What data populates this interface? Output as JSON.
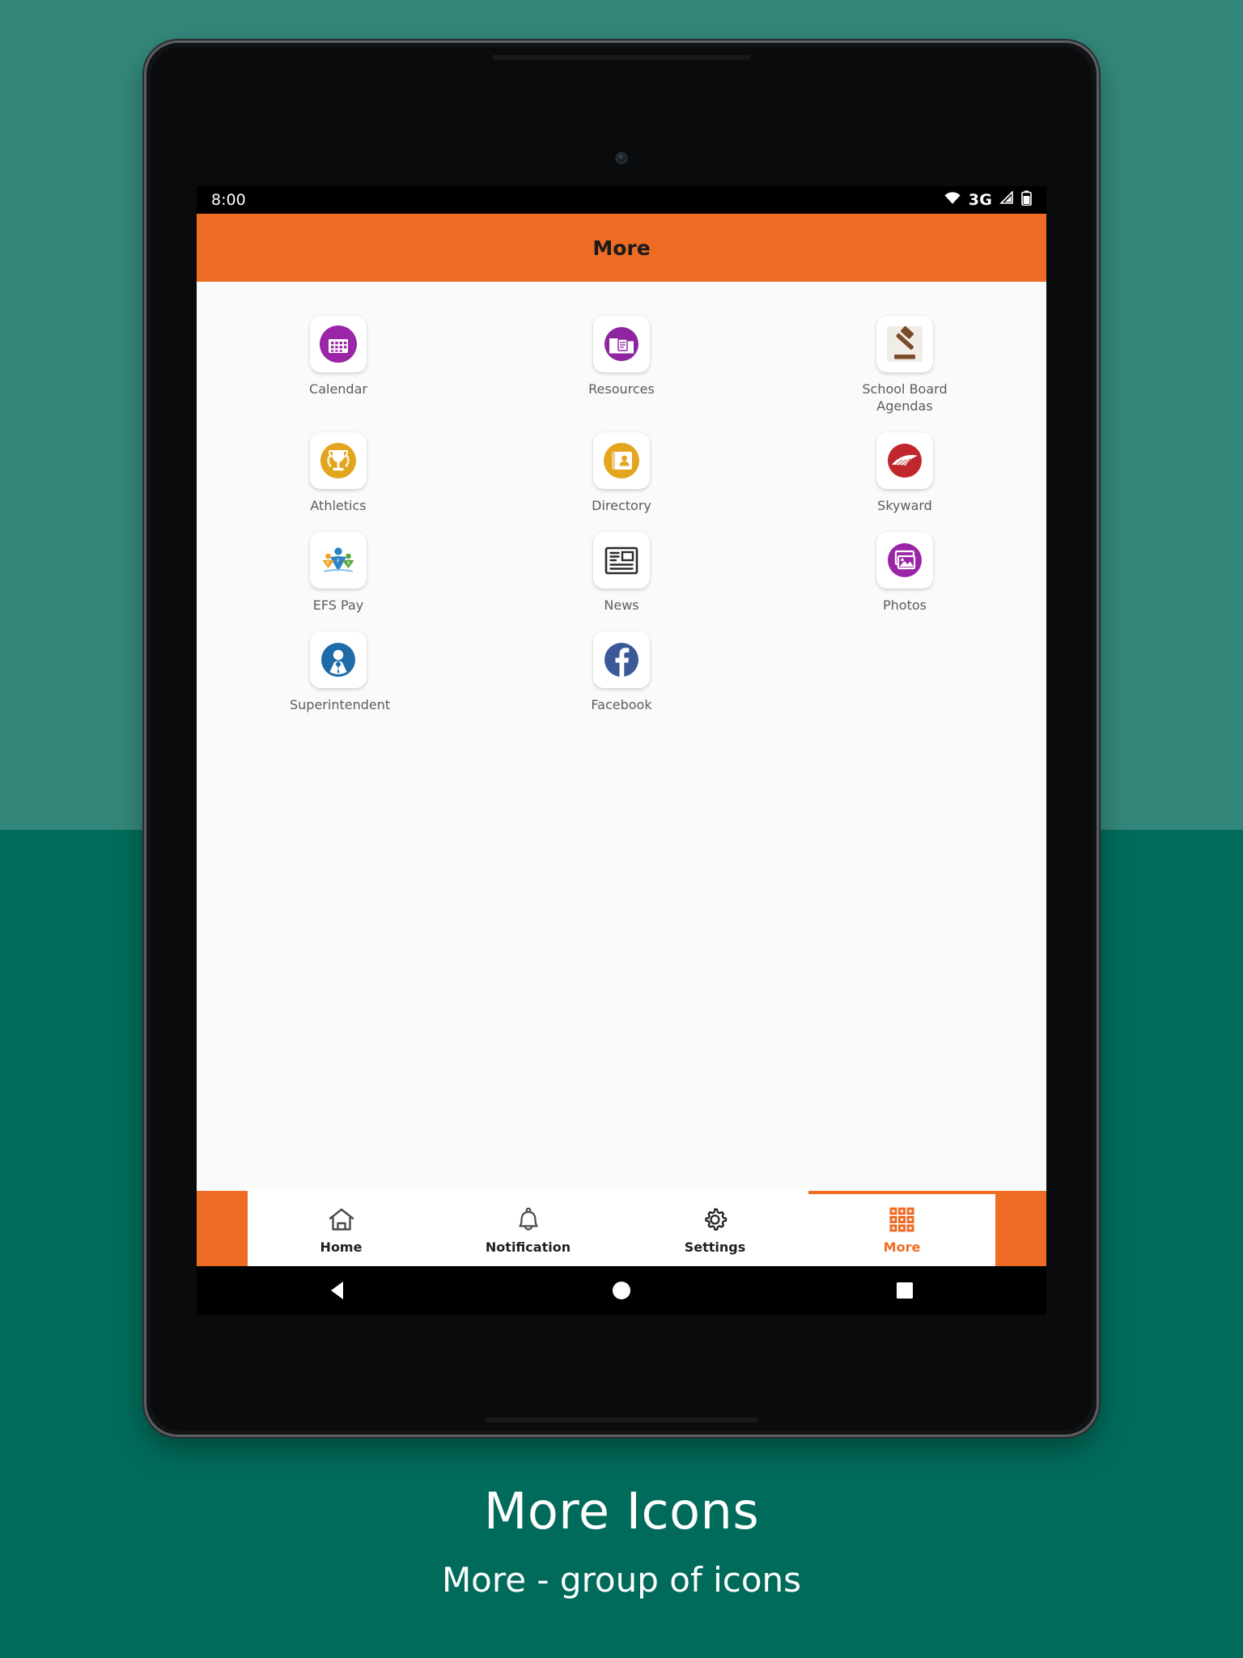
{
  "background": {
    "top_color": "#33877A",
    "bottom_color": "#006B5A"
  },
  "device": {
    "type": "android-tablet",
    "frame_color": "#111315"
  },
  "status_bar": {
    "time": "8:00",
    "network_label": "3G",
    "icons": [
      "wifi-icon",
      "signal-icon",
      "battery-icon"
    ],
    "background": "#000000"
  },
  "app_bar": {
    "title": "More",
    "background": "#EF6C25",
    "text_color": "#1b1b1b"
  },
  "tiles": [
    {
      "label": "Calendar",
      "icon": "calendar-icon",
      "color": "#9B25A7"
    },
    {
      "label": "Resources",
      "icon": "folder-document-icon",
      "color": "#8E24A0"
    },
    {
      "label": "School Board\nAgendas",
      "icon": "gavel-icon",
      "color": "#7B4A28"
    },
    {
      "label": "Athletics",
      "icon": "trophy-icon",
      "color": "#E3A51E"
    },
    {
      "label": "Directory",
      "icon": "contact-card-icon",
      "color": "#E3A51E"
    },
    {
      "label": "Skyward",
      "icon": "skyward-wing-icon",
      "color": "#C0272D"
    },
    {
      "label": "EFS Pay",
      "icon": "efs-people-book-icon",
      "color": "#2D82C4"
    },
    {
      "label": "News",
      "icon": "newspaper-icon",
      "color": "#2b2b2b"
    },
    {
      "label": "Photos",
      "icon": "photos-icon",
      "color": "#9B25A7"
    },
    {
      "label": "Superintendent",
      "icon": "person-suit-icon",
      "color": "#1E6BA8"
    },
    {
      "label": "Facebook",
      "icon": "facebook-icon",
      "color": "#3B5998"
    }
  ],
  "tab_bar": {
    "active_color": "#EF6C25",
    "inactive_color": "#1f1f1f",
    "tabs": [
      {
        "label": "Home",
        "icon": "home-icon",
        "active": false
      },
      {
        "label": "Notification",
        "icon": "bell-icon",
        "active": false
      },
      {
        "label": "Settings",
        "icon": "gear-icon",
        "active": false
      },
      {
        "label": "More",
        "icon": "grid-3x3-icon",
        "active": true
      }
    ]
  },
  "nav_bar": {
    "buttons": [
      "back-triangle-icon",
      "home-circle-icon",
      "recents-square-icon"
    ]
  },
  "caption": {
    "title": "More Icons",
    "subtitle": "More - group of icons"
  }
}
